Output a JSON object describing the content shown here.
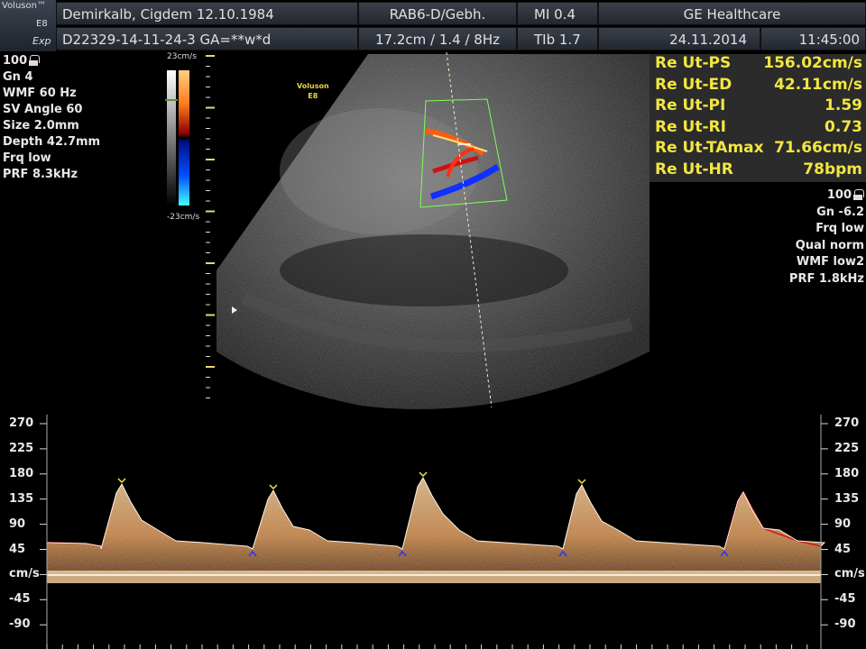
{
  "logo": {
    "brand": "Voluson™",
    "model": "E8",
    "edition": "Exp"
  },
  "header": {
    "patient": "Demirkalb, Cigdem  12.10.1984",
    "patient_id": "D22329-14-11-24-3  GA=**w*d",
    "probe": "RAB6-D/Gebh.",
    "depth_info": "17.2cm / 1.4 /  8Hz",
    "mi": "MI  0.4",
    "tib": "TIb  1.7",
    "vendor": "GE Healthcare",
    "date": "24.11.2014",
    "time": "11:45:00"
  },
  "left_params": [
    "Gn  4",
    "WMF 60 Hz",
    "SV Angle 60",
    "Size  2.0mm",
    "Depth 42.7mm",
    "Frq low",
    "PRF  8.3kHz"
  ],
  "left_power": "100",
  "right_power": "100",
  "right_params": [
    "Gn -6.2",
    "Frq low",
    "Qual norm",
    "WMF low2",
    "PRF  1.8kHz"
  ],
  "colorbar": {
    "top": "23cm/s",
    "bottom": "-23cm/s"
  },
  "watermark": {
    "line1": "Voluson",
    "line2": "E8"
  },
  "measurements": [
    {
      "label": "Re Ut-PS",
      "value": "156.02cm/s"
    },
    {
      "label": "Re Ut-ED",
      "value": "42.11cm/s"
    },
    {
      "label": "Re Ut-PI",
      "value": "1.59"
    },
    {
      "label": "Re Ut-RI",
      "value": "0.73"
    },
    {
      "label": "Re Ut-TAmax",
      "value": "71.66cm/s"
    },
    {
      "label": "Re Ut-HR",
      "value": "78bpm"
    }
  ],
  "doppler_axis": {
    "unit": "cm/s",
    "ticks": [
      "270",
      "225",
      "180",
      "135",
      "90",
      "45",
      "cm/s",
      "-45",
      "-90"
    ]
  },
  "colors": {
    "measure_text": "#f2e640",
    "doppler": "#f0a050",
    "envelope_red": "#d01818"
  }
}
